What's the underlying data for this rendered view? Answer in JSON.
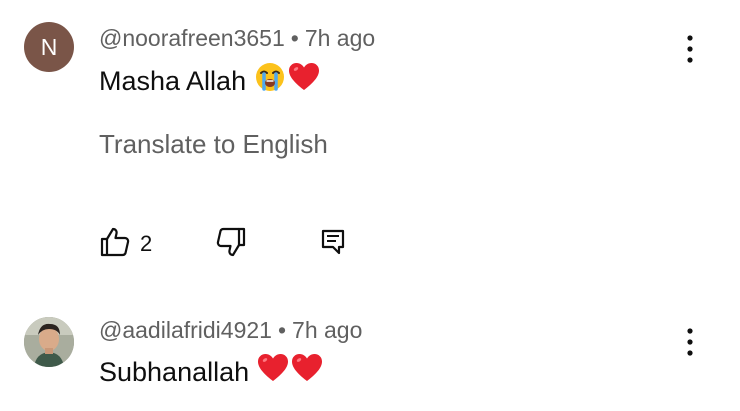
{
  "comments": [
    {
      "avatar_letter": "N",
      "avatar_color": "#7a5548",
      "author": "@noorafreen3651",
      "separator": "•",
      "time": "7h ago",
      "text": "Masha Allah",
      "emojis": [
        "loudly-crying-face",
        "red-heart"
      ],
      "translate_label": "Translate to English",
      "like_count": "2"
    },
    {
      "avatar_type": "photo",
      "author": "@aadilafridi4921",
      "separator": "•",
      "time": "7h ago",
      "text": "Subhanallah",
      "emojis": [
        "red-heart",
        "red-heart"
      ]
    }
  ],
  "colors": {
    "secondary_text": "#606060",
    "primary_text": "#0f0f0f",
    "heart": "#e8212e"
  }
}
